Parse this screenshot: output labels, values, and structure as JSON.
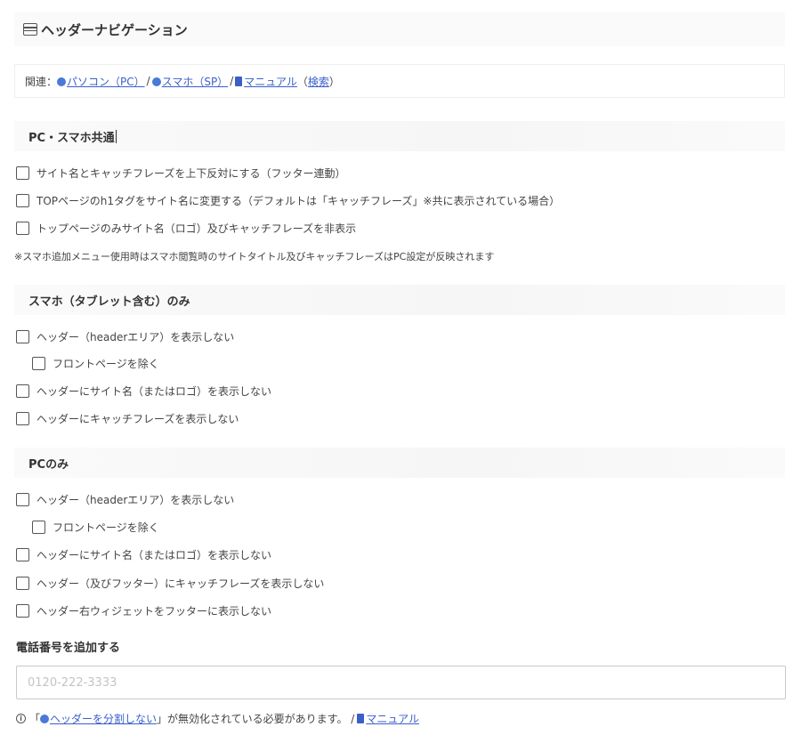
{
  "header": {
    "title": "ヘッダーナビゲーション",
    "icon": "table-icon"
  },
  "related": {
    "prefix": "関連：",
    "link_pc": "パソコン（PC）",
    "link_sp": "スマホ（SP）",
    "link_manual": "マニュアル",
    "paren_open": "（",
    "link_search": "検索",
    "paren_close": "）",
    "sep": "/"
  },
  "sections": {
    "common": {
      "title": "PC・スマホ共通",
      "options": [
        "サイト名とキャッチフレーズを上下反対にする（フッター連動）",
        "TOPページのh1タグをサイト名に変更する（デフォルトは「キャッチフレーズ」※共に表示されている場合）",
        "トップページのみサイト名（ロゴ）及びキャッチフレーズを非表示"
      ],
      "note": "※スマホ追加メニュー使用時はスマホ閲覧時のサイトタイトル及びキャッチフレーズはPC設定が反映されます"
    },
    "sp": {
      "title": "スマホ（タブレット含む）のみ",
      "options": [
        "ヘッダー（headerエリア）を表示しない",
        "フロントページを除く",
        "ヘッダーにサイト名（またはロゴ）を表示しない",
        "ヘッダーにキャッチフレーズを表示しない"
      ]
    },
    "pc": {
      "title": "PCのみ",
      "options": [
        "ヘッダー（headerエリア）を表示しない",
        "フロントページを除く",
        "ヘッダーにサイト名（またはロゴ）を表示しない",
        "ヘッダー（及びフッター）にキャッチフレーズを表示しない",
        "ヘッダー右ウィジェットをフッターに表示しない"
      ]
    }
  },
  "phone": {
    "label": "電話番号を追加する",
    "placeholder": "0120-222-3333",
    "value": ""
  },
  "notice": {
    "icon": "info-icon",
    "text_before": "「",
    "link": "ヘッダーを分割しない",
    "text_after": "」が無効化されている必要があります。 /",
    "manual": "マニュアル"
  },
  "colors": {
    "link": "#3a5fcd",
    "section_bg": "#fafafa",
    "text": "#333333"
  }
}
